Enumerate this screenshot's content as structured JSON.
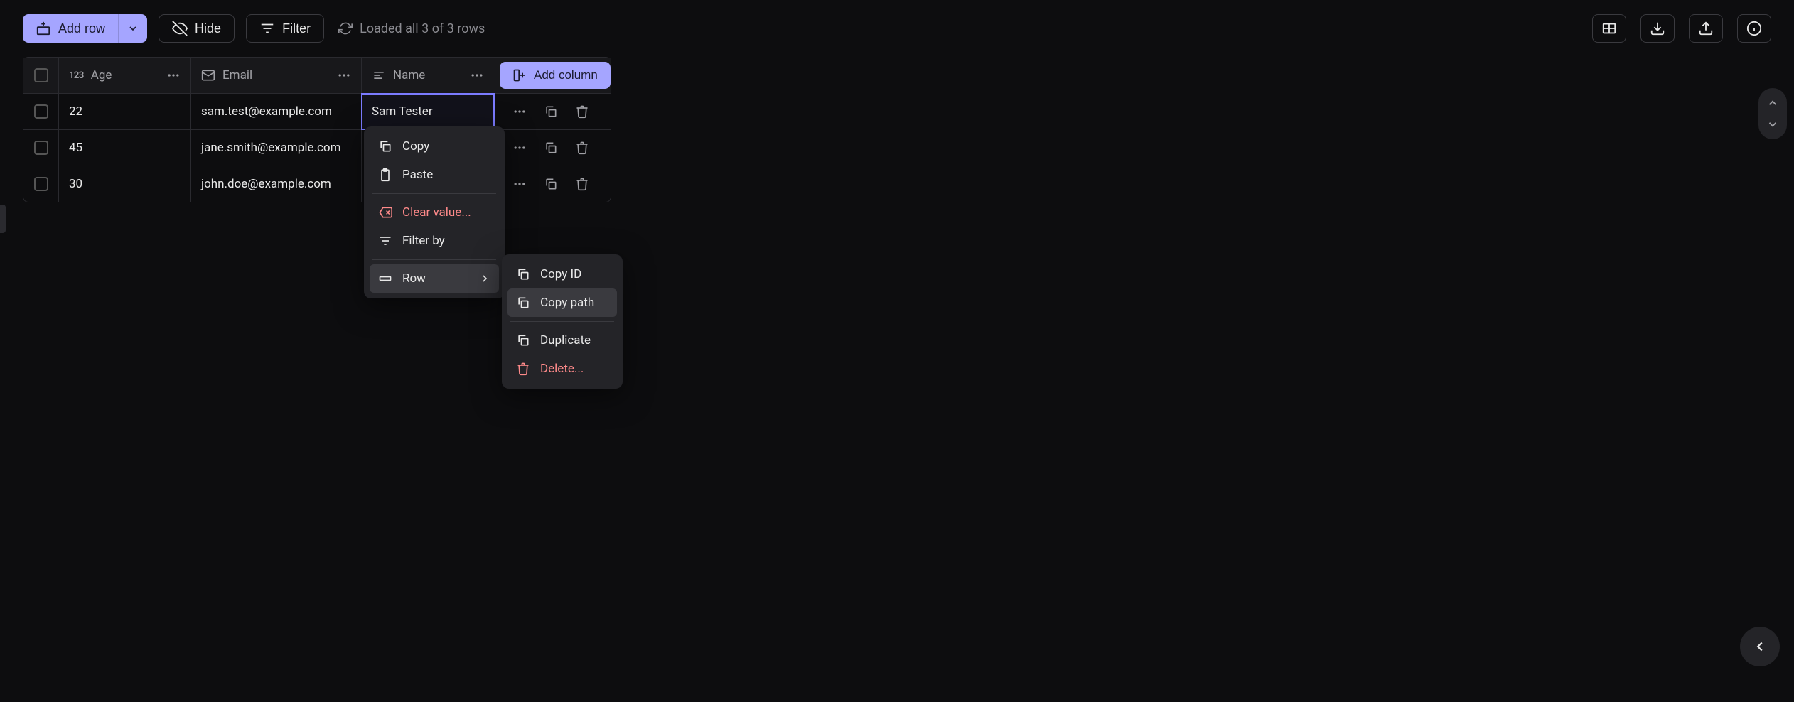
{
  "toolbar": {
    "add_row": "Add row",
    "hide": "Hide",
    "filter": "Filter",
    "status": "Loaded all 3 of 3 rows"
  },
  "columns": {
    "age": "Age",
    "email": "Email",
    "name": "Name",
    "add": "Add column"
  },
  "rows": [
    {
      "age": "22",
      "email": "sam.test@example.com",
      "name": "Sam Tester"
    },
    {
      "age": "45",
      "email": "jane.smith@example.com",
      "name": ""
    },
    {
      "age": "30",
      "email": "john.doe@example.com",
      "name": ""
    }
  ],
  "ctx1": {
    "copy": "Copy",
    "paste": "Paste",
    "clear": "Clear value...",
    "filter_by": "Filter by",
    "row": "Row"
  },
  "ctx2": {
    "copy_id": "Copy ID",
    "copy_path": "Copy path",
    "duplicate": "Duplicate",
    "delete": "Delete..."
  }
}
